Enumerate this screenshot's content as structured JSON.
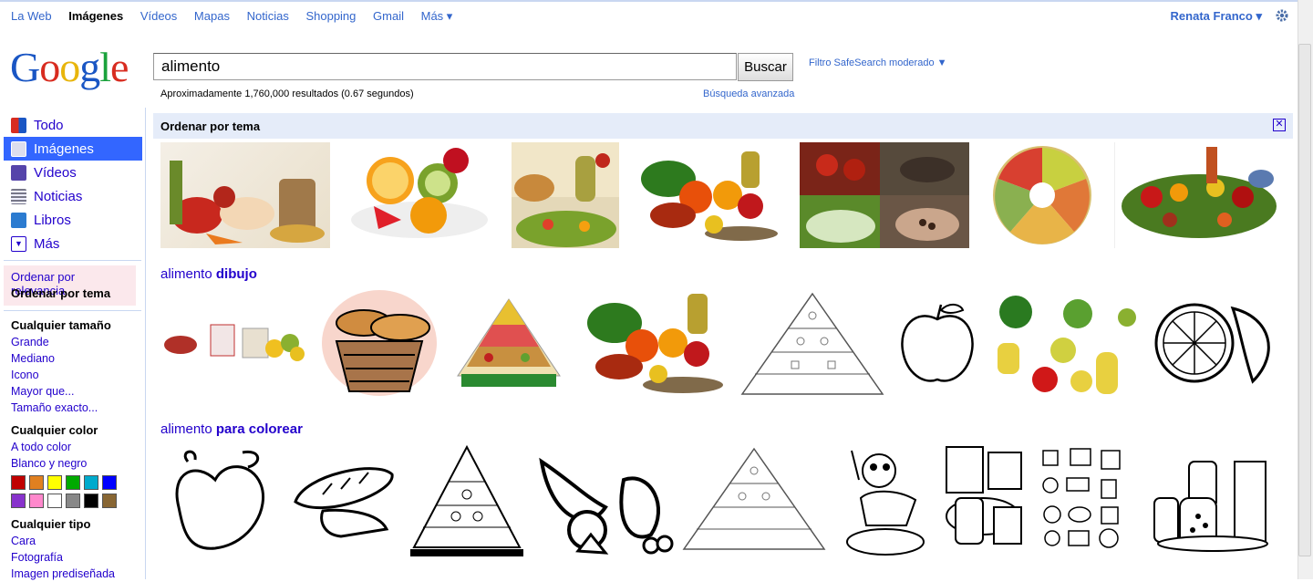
{
  "topnav": {
    "items": [
      "La Web",
      "Imágenes",
      "Vídeos",
      "Mapas",
      "Noticias",
      "Shopping",
      "Gmail",
      "Más ▾"
    ],
    "user": "Renata Franco ▾"
  },
  "search": {
    "query": "alimento",
    "button": "Buscar",
    "safesearch": "Filtro SafeSearch moderado ▼",
    "results": "Aproximadamente 1,760,000 resultados (0.67 segundos)",
    "advanced": "Búsqueda avanzada"
  },
  "leftnav": {
    "items": [
      "Todo",
      "Imágenes",
      "Vídeos",
      "Noticias",
      "Libros",
      "Más"
    ],
    "sort_relevance": "Ordenar por relevancia",
    "sort_topic": "Ordenar por tema",
    "size_title": "Cualquier tamaño",
    "sizes": [
      "Grande",
      "Mediano",
      "Icono",
      "Mayor que...",
      "Tamaño exacto..."
    ],
    "color_title": "Cualquier color",
    "colors": [
      "A todo color",
      "Blanco y negro"
    ],
    "swatches": [
      "#c00000",
      "#e08020",
      "#ffff00",
      "#00aa00",
      "#00aacc",
      "#0000ff",
      "#8833cc",
      "#ff88cc",
      "#ffffff",
      "#888888",
      "#000000",
      "#886633"
    ],
    "type_title": "Cualquier tipo",
    "types": [
      "Cara",
      "Fotografía",
      "Imagen prediseñada"
    ]
  },
  "main": {
    "tema_title": "Ordenar por tema",
    "group1_q": "alimento",
    "group1_b": "dibujo",
    "group2_q": "alimento",
    "group2_b": "para colorear"
  }
}
